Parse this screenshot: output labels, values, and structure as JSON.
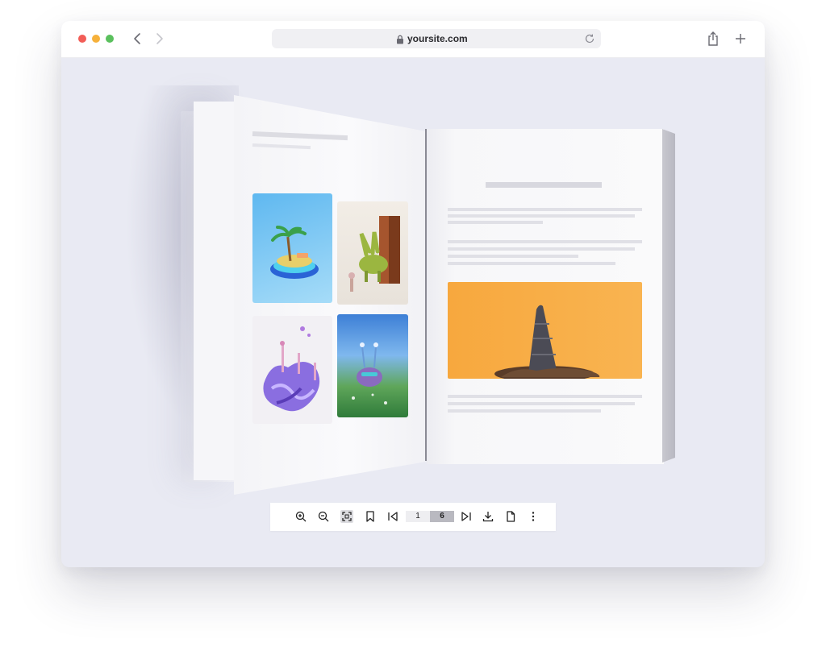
{
  "browser": {
    "url": "yoursite.com"
  },
  "icons": {
    "back": "chevron-left-icon",
    "forward": "chevron-right-icon",
    "lock": "lock-icon",
    "reload": "reload-icon",
    "share": "share-icon",
    "new_tab": "plus-icon"
  },
  "viewer": {
    "toolbar": {
      "current_page": "1",
      "total_pages": "6"
    }
  },
  "colors": {
    "window_bg": "#e9eaf3",
    "traffic_red": "#f25d57",
    "traffic_yellow": "#f6b13b",
    "traffic_green": "#5ac05d",
    "photo_orange": "#f7a83e"
  }
}
